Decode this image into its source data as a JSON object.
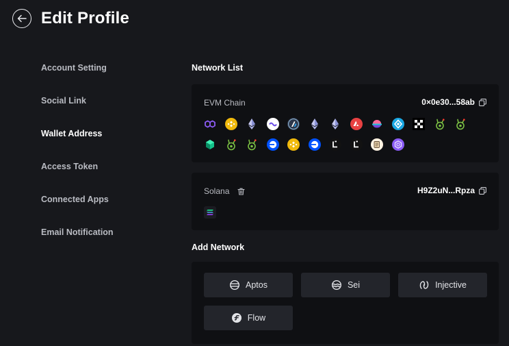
{
  "header": {
    "title": "Edit Profile"
  },
  "sidebar": {
    "items": [
      {
        "label": "Account Setting"
      },
      {
        "label": "Social Link"
      },
      {
        "label": "Wallet Address"
      },
      {
        "label": "Access Token"
      },
      {
        "label": "Connected Apps"
      },
      {
        "label": "Email Notification"
      }
    ],
    "active_index": 2
  },
  "network_list": {
    "title": "Network List",
    "evm": {
      "name": "EVM Chain",
      "address": "0×0e30...58ab",
      "icons_row1": [
        "polygon-icon",
        "bnb-icon",
        "ethereum-icon",
        "bridge-icon",
        "arbitrum-icon",
        "ethereum-icon",
        "ethereum-icon",
        "avalanche-icon",
        "fantom-icon",
        "celo-icon",
        "okx-icon",
        "kava-icon",
        "kava-icon"
      ],
      "icons_row2": [
        "cube-icon",
        "kava-icon",
        "kava-icon",
        "base-icon",
        "bnb-icon",
        "base-icon",
        "linea-icon",
        "linea-icon",
        "scroll-icon",
        "zksync-icon"
      ]
    },
    "solana": {
      "name": "Solana",
      "address": "H9Z2uN...Rpza",
      "icons": [
        "solana-icon"
      ]
    }
  },
  "add_network": {
    "title": "Add Network",
    "buttons": [
      {
        "label": "Aptos",
        "icon": "aptos-icon"
      },
      {
        "label": "Sei",
        "icon": "sei-icon"
      },
      {
        "label": "Injective",
        "icon": "injective-icon"
      },
      {
        "label": "Flow",
        "icon": "flow-icon"
      }
    ]
  },
  "colors": {
    "background": "#17181c",
    "card": "#0f1013",
    "button": "#23252b"
  }
}
